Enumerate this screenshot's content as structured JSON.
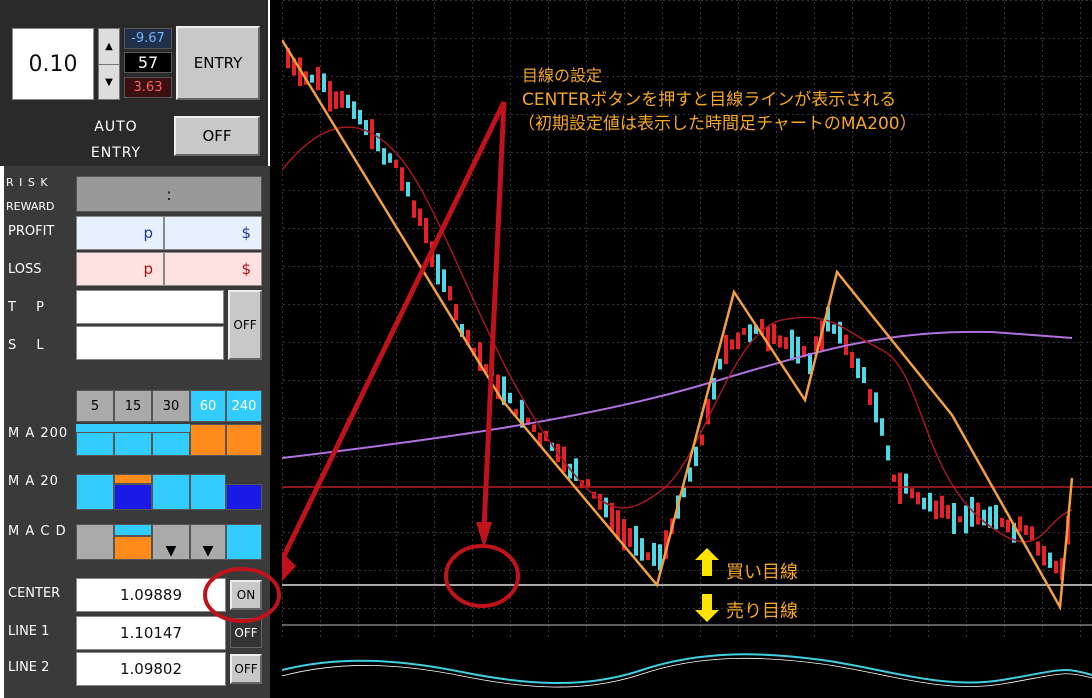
{
  "panel": {
    "lot": "0.10",
    "val_top": "-9.67",
    "val_mid": "57",
    "val_bot": "3.63",
    "entry_label": "ENTRY",
    "auto_entry_label": "AUTO ENTRY",
    "auto_entry_state": "OFF",
    "risk_label": "R I S K",
    "reward_label": "REWARD",
    "rr_value": ":",
    "profit_label": "PROFIT",
    "profit_p": "p",
    "profit_d": "$",
    "loss_label": "LOSS",
    "loss_p": "p",
    "loss_d": "$",
    "tp_label": "T P",
    "sl_label": "S L",
    "tpsl_state": "OFF",
    "timeframes": [
      "5",
      "15",
      "30",
      "60",
      "240"
    ],
    "ma200_label": "M A 200",
    "ma20_label": "M A 20",
    "macd_label": "M A C D",
    "center_label": "CENTER",
    "center_value": "1.09889",
    "center_state": "ON",
    "line1_label": "LINE 1",
    "line1_value": "1.10147",
    "line1_state": "OFF",
    "line2_label": "LINE 2",
    "line2_value": "1.09802",
    "line2_state": "OFF"
  },
  "annotation": {
    "line1": "目線の設定",
    "line2": "CENTERボタンを押すと目線ラインが表示される",
    "line3": "（初期設定値は表示した時間足チャートのMA200）",
    "buy_label": "買い目線",
    "sell_label": "売り目線"
  },
  "colors": {
    "cyan": "#33ccff",
    "orange": "#ff8c1a",
    "annotation": "#f5a623",
    "arrow_red": "#c0121b",
    "candle_up": "#4dd9e6",
    "candle_down": "#e8202a"
  }
}
